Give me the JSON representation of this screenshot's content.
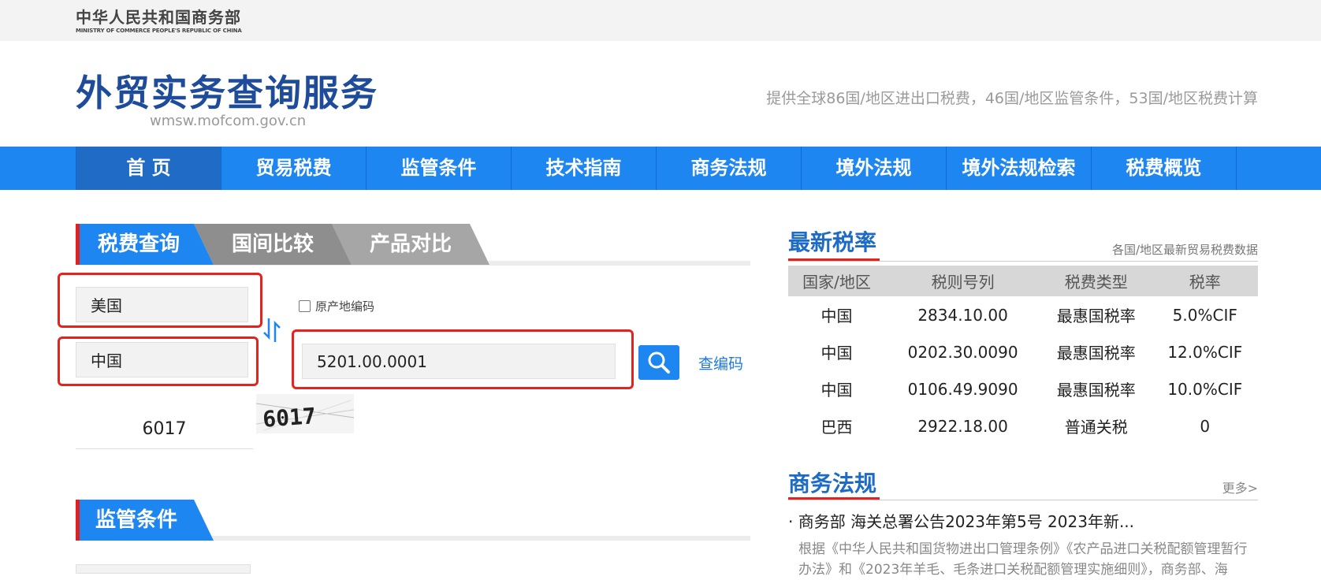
{
  "header": {
    "ministry_cn": "中华人民共和国商务部",
    "ministry_en": "MINISTRY OF COMMERCE PEOPLE'S REPUBLIC OF CHINA",
    "site_title": "外贸实务查询服务",
    "site_domain": "wmsw.mofcom.gov.cn",
    "slogan": "提供全球86国/地区进出口税费，46国/地区监管条件，53国/地区税费计算"
  },
  "nav": {
    "items": [
      {
        "label": "首 页"
      },
      {
        "label": "贸易税费"
      },
      {
        "label": "监管条件"
      },
      {
        "label": "技术指南"
      },
      {
        "label": "商务法规"
      },
      {
        "label": "境外法规"
      },
      {
        "label": "境外法规检索"
      },
      {
        "label": "税费概览"
      }
    ],
    "active_index": 0
  },
  "query": {
    "tabs": [
      {
        "label": "税费查询"
      },
      {
        "label": "国间比较"
      },
      {
        "label": "产品对比"
      }
    ],
    "from_country": "美国",
    "to_country": "中国",
    "origin_code_label": "原产地编码",
    "hs_code_value": "5201.00.0001",
    "code_link": "查编码",
    "captcha_value": "6017",
    "captcha_image_text": "6017"
  },
  "section2": {
    "title": "监管条件"
  },
  "latest_rates": {
    "title": "最新税率",
    "subtitle": "各国/地区最新贸易税费数据",
    "columns": [
      "国家/地区",
      "税则号列",
      "税费类型",
      "税率"
    ],
    "rows": [
      [
        "中国",
        "2834.10.00",
        "最惠国税率",
        "5.0%CIF"
      ],
      [
        "中国",
        "0202.30.0090",
        "最惠国税率",
        "12.0%CIF"
      ],
      [
        "中国",
        "0106.49.9090",
        "最惠国税率",
        "10.0%CIF"
      ],
      [
        "巴西",
        "2922.18.00",
        "普通关税",
        "0"
      ]
    ]
  },
  "regulations": {
    "title": "商务法规",
    "more": "更多>",
    "item_title": "· 商务部 海关总署公告2023年第5号 2023年新...",
    "item_desc": "根据《中华人民共和国货物进出口管理条例》《农产品进口关税配额管理暂行办法》和《2023年羊毛、毛条进口关税配额管理实施细则》，商务部、海"
  },
  "colors": {
    "nav_blue": "#1e86f0",
    "nav_active": "#1f6bc6",
    "title_blue": "#1e4c9a",
    "accent_red": "#e5231e"
  }
}
